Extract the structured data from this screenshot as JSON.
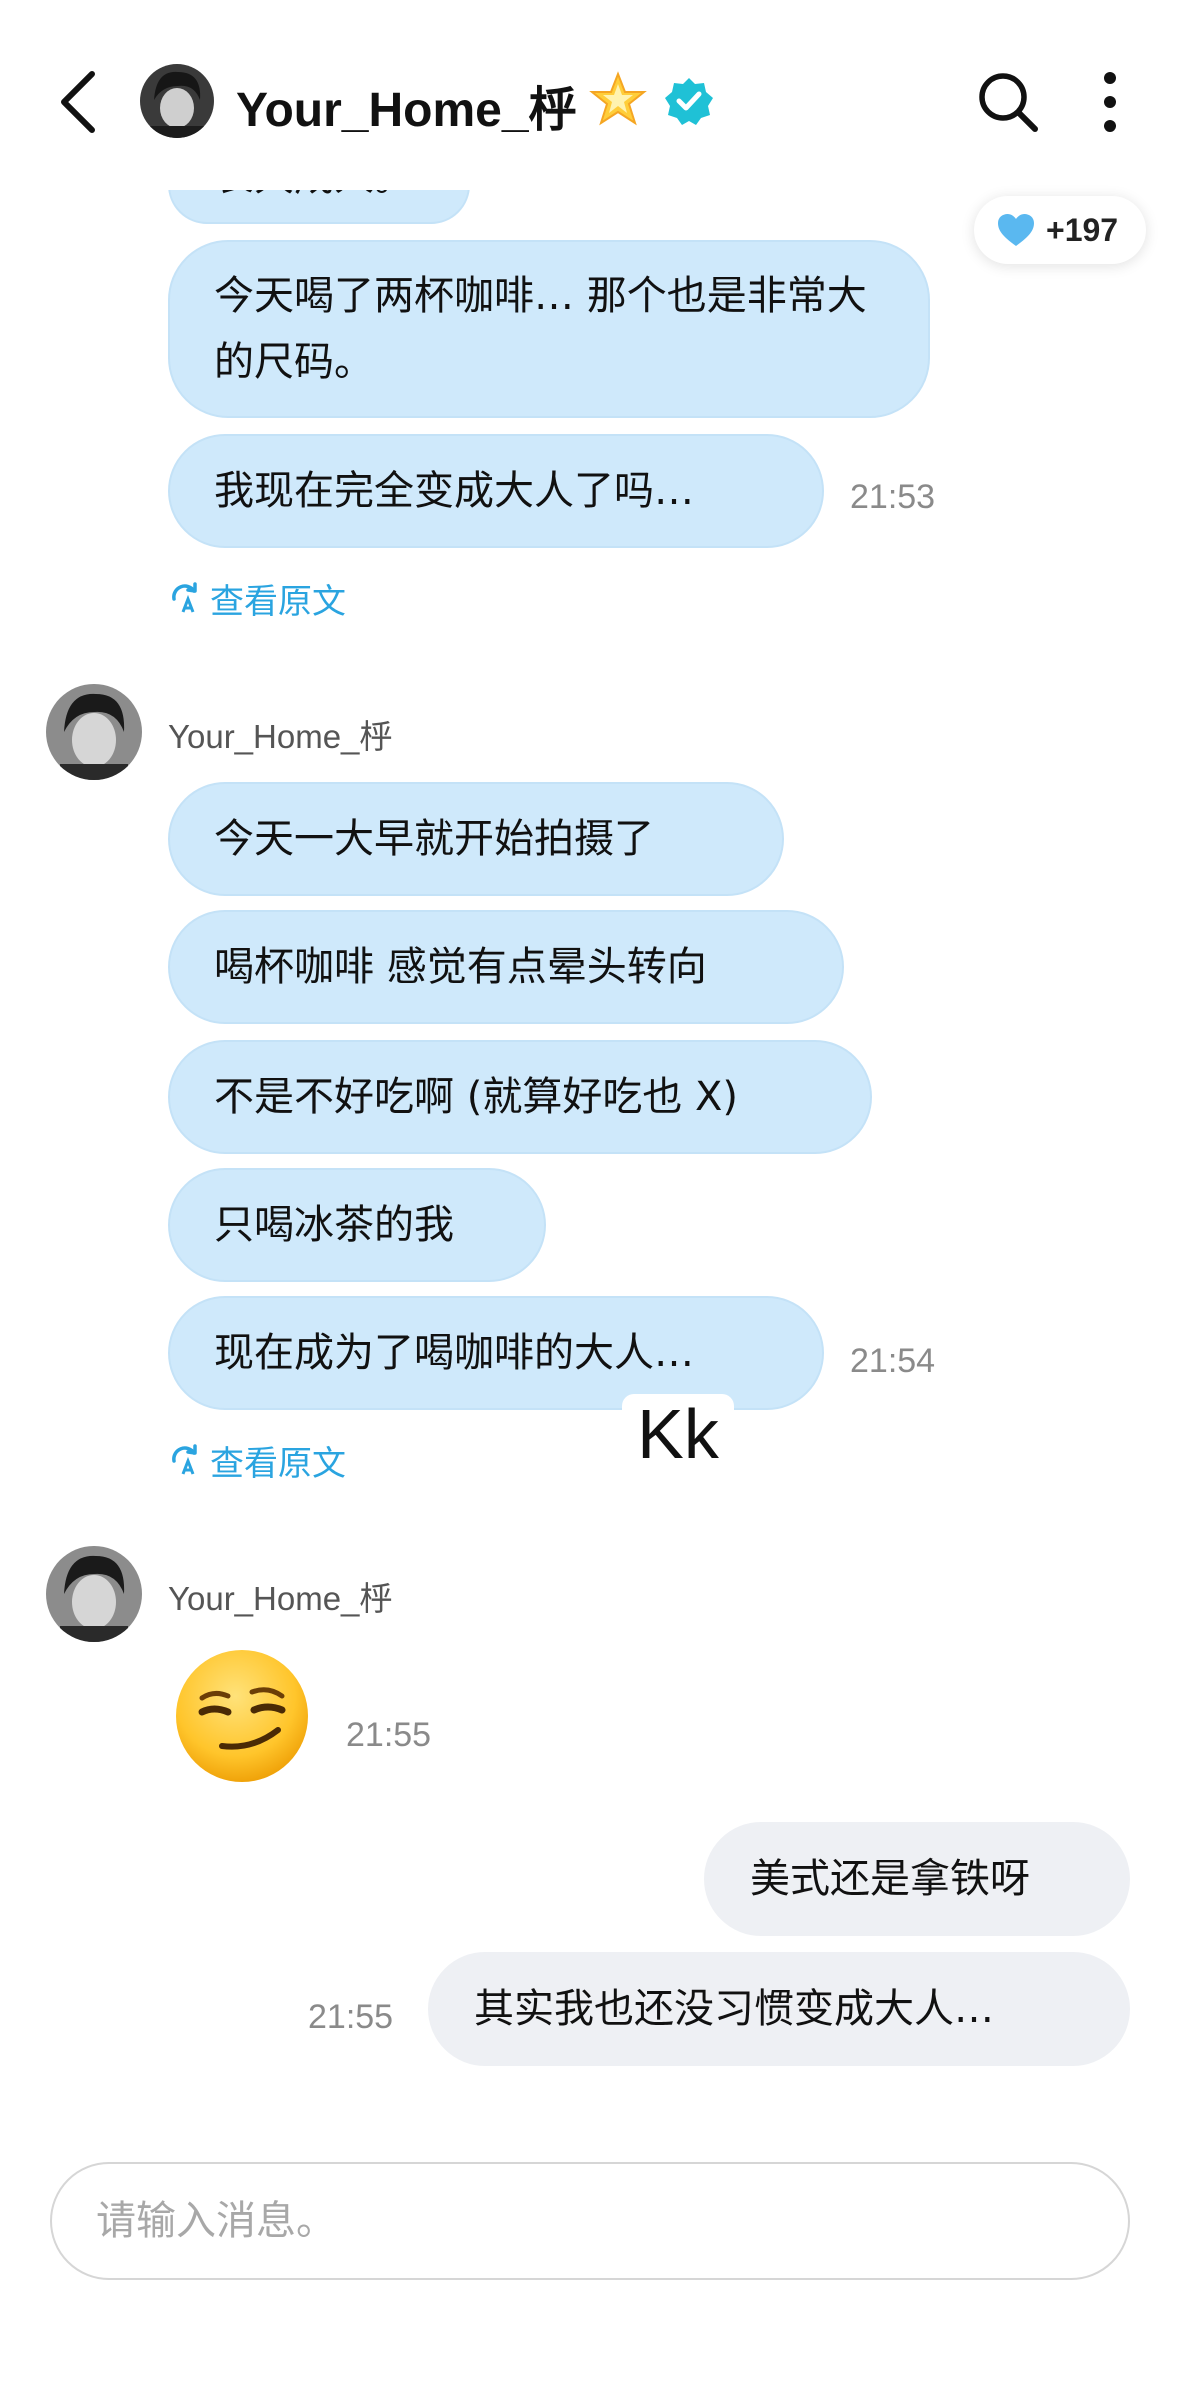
{
  "header": {
    "username": "Your_Home_㭔",
    "star_emoji": "🌟"
  },
  "likes": {
    "count": "+197"
  },
  "messages_top": {
    "partial": "长大成人。",
    "m1": "今天喝了两杯咖啡… 那个也是非常大的尺码。",
    "m2": "我现在完全变成大人了吗…",
    "time": "21:53",
    "translate": "查看原文"
  },
  "group2": {
    "sender": "Your_Home_㭔",
    "m1": "今天一大早就开始拍摄了",
    "m2": "喝杯咖啡 感觉有点晕头转向",
    "m3": "不是不好吃啊 (就算好吃也 X)",
    "m4": "只喝冰茶的我",
    "m5": "现在成为了喝咖啡的大人…",
    "time": "21:54",
    "translate": "查看原文",
    "sticker_text": "Kk"
  },
  "group3": {
    "sender": "Your_Home_㭔",
    "emoji": "smirking-face",
    "time": "21:55"
  },
  "mine": {
    "m1": "美式还是拿铁呀",
    "m2": "其实我也还没习惯变成大人…",
    "time": "21:55"
  },
  "input": {
    "placeholder": "请输入消息。"
  },
  "colors": {
    "bubble_blue": "#cfe9fb",
    "bubble_mine": "#eef0f4",
    "link_blue": "#2aa4e0",
    "verified_teal": "#1fc1d6",
    "heart_blue": "#5ab8f0"
  },
  "icons": [
    "back-icon",
    "star-icon",
    "verified-icon",
    "search-icon",
    "more-icon",
    "heart-icon",
    "translate-icon",
    "smirking-face-icon"
  ]
}
